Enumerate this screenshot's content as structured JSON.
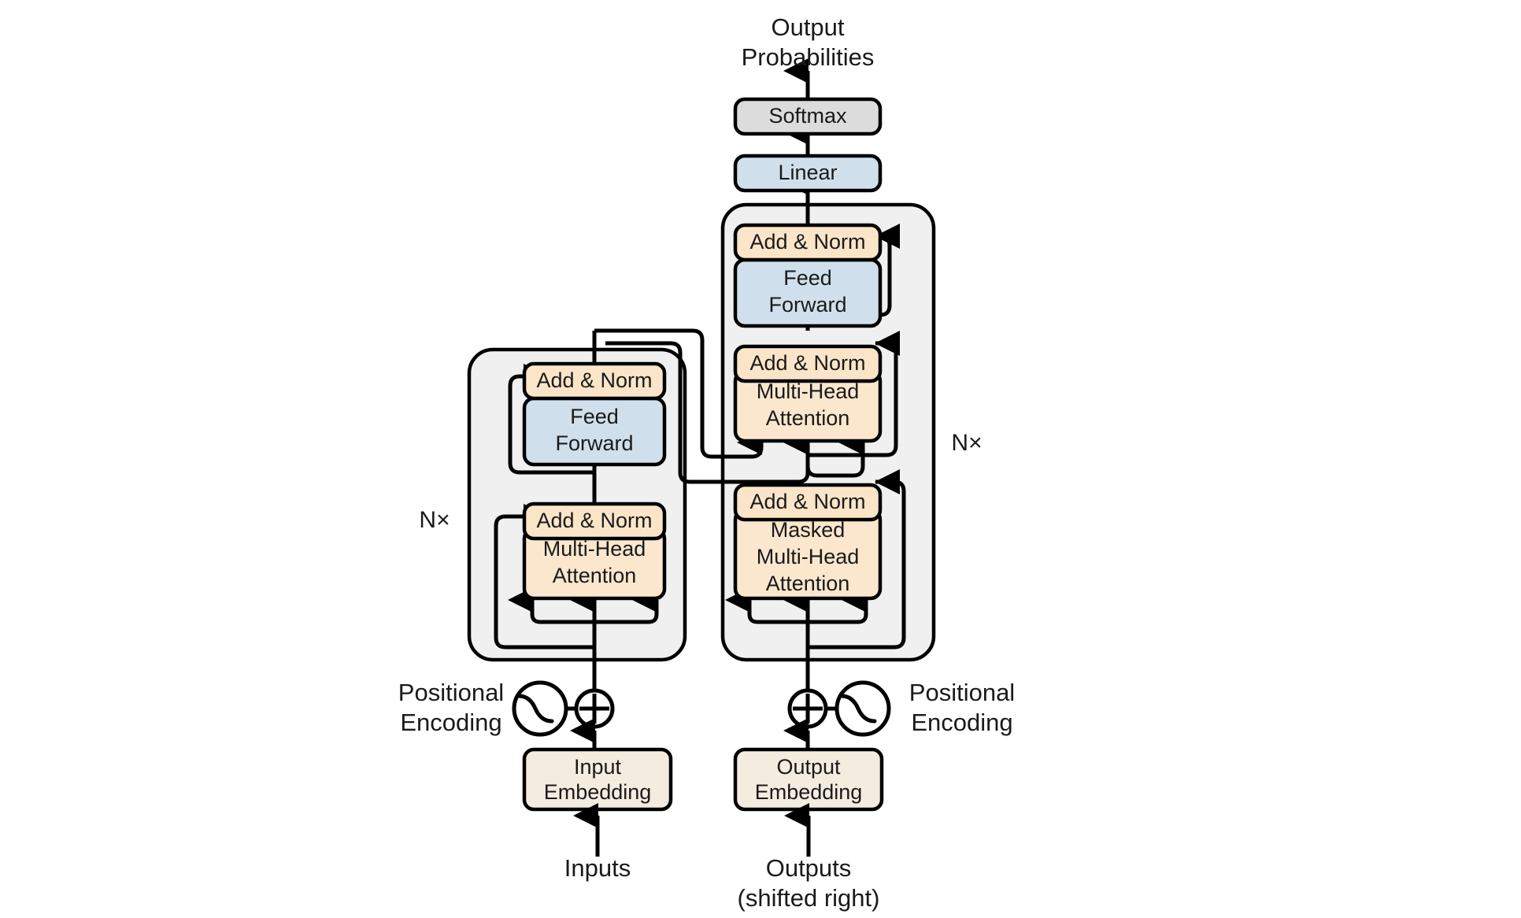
{
  "figure": {
    "title": "The Transformer - model architecture",
    "type": "diagram"
  },
  "top": {
    "output_label_line1": "Output",
    "output_label_line2": "Probabilities",
    "softmax": "Softmax",
    "linear": "Linear"
  },
  "encoder": {
    "nx_label": "N×",
    "add_norm_top": "Add & Norm",
    "feed_forward_line1": "Feed",
    "feed_forward_line2": "Forward",
    "add_norm_bottom": "Add & Norm",
    "attention_line1": "Multi-Head",
    "attention_line2": "Attention",
    "positional_line1": "Positional",
    "positional_line2": "Encoding",
    "embedding_line1": "Input",
    "embedding_line2": "Embedding",
    "input_label": "Inputs"
  },
  "decoder": {
    "nx_label": "N×",
    "add_norm_top": "Add & Norm",
    "feed_forward_line1": "Feed",
    "feed_forward_line2": "Forward",
    "add_norm_mid": "Add & Norm",
    "cross_attention_line1": "Multi-Head",
    "cross_attention_line2": "Attention",
    "add_norm_bottom": "Add & Norm",
    "masked_attention_line1": "Masked",
    "masked_attention_line2": "Multi-Head",
    "masked_attention_line3": "Attention",
    "positional_line1": "Positional",
    "positional_line2": "Encoding",
    "embedding_line1": "Output",
    "embedding_line2": "Embedding",
    "output_label_line1": "Outputs",
    "output_label_line2": "(shifted right)"
  },
  "colors": {
    "background": "#ffffff",
    "panel_fill": "#f0f0f0",
    "stroke": "#000000",
    "add_norm_fill": "#fbe5c8",
    "attention_fill": "#fbe7cd",
    "feed_forward_fill": "#cfe0ec",
    "linear_fill": "#cfe0ec",
    "softmax_fill": "#dcdcdc",
    "embedding_fill": "#f5ece0",
    "text": "#1a1a1a"
  }
}
